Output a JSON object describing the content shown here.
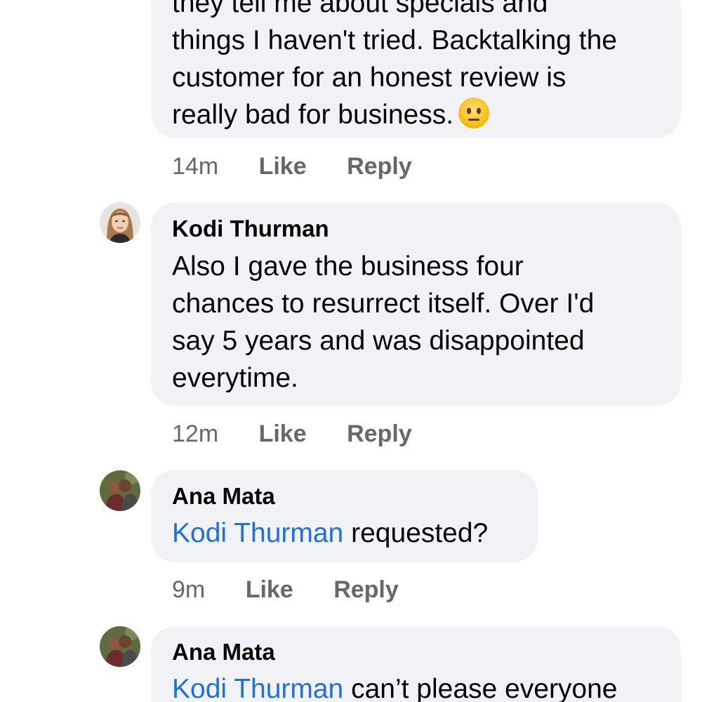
{
  "comments": [
    {
      "text_lines": [
        "they tell me about specials and",
        "things I haven't tried. Backtalking the",
        "customer for an honest review is",
        "really bad for business."
      ],
      "emoji": "neutral-face-emoji",
      "time": "14m",
      "like_label": "Like",
      "reply_label": "Reply"
    },
    {
      "author": "Kodi Thurman",
      "text_lines": [
        "Also I gave the business four",
        "chances to resurrect itself. Over I'd",
        "say 5 years and was disappointed",
        "everytime."
      ],
      "time": "12m",
      "like_label": "Like",
      "reply_label": "Reply"
    },
    {
      "author": "Ana Mata",
      "mention": "Kodi Thurman",
      "text": " requested?",
      "time": "9m",
      "like_label": "Like",
      "reply_label": "Reply"
    },
    {
      "author": "Ana Mata",
      "mention": "Kodi Thurman",
      "text": " can’t please everyone"
    }
  ],
  "colors": {
    "bubble_bg": "#f0f2f5",
    "mention": "#216fdb",
    "meta_text": "#65676b",
    "name_text": "#050505"
  }
}
